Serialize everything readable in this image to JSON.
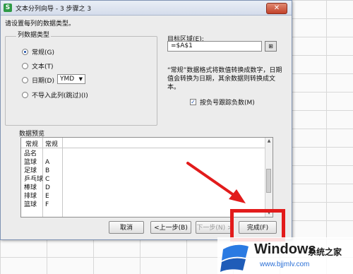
{
  "dialog": {
    "title": "文本分列向导 - 3 步骤之 3",
    "close_glyph": "✕",
    "app_icon_letter": "S",
    "instruction": "请设置每列的数据类型。"
  },
  "column_type": {
    "legend": "列数据类型",
    "options": [
      {
        "label": "常规(G)",
        "checked": true
      },
      {
        "label": "文本(T)",
        "checked": false
      },
      {
        "label": "日期(D)",
        "checked": false
      },
      {
        "label": "不导入此列(跳过)(I)",
        "checked": false
      }
    ],
    "date_format": "YMD"
  },
  "destination": {
    "label": "目标区域(E):",
    "value": "=$A$1"
  },
  "description": "“常规”数据格式将数值转换成数字，日期值会转换为日期，其余数据则转换成文本。",
  "negative_checkbox": {
    "label": "按负号跟踪负数(M)",
    "checked": true
  },
  "preview": {
    "label": "数据预览",
    "headers": [
      "常规",
      "常规"
    ],
    "col1": [
      "品名",
      "篮球",
      "足球",
      "乒乓球",
      "棒球",
      "排球",
      "篮球"
    ],
    "col2": [
      "",
      "A",
      "B",
      "C",
      "D",
      "E",
      "F"
    ]
  },
  "buttons": {
    "cancel": "取消",
    "back": "<上一步(B)",
    "next": "下一步(N) >",
    "finish": "完成(F)"
  },
  "watermark": {
    "title": "Windows",
    "subtitle": "系统之家",
    "url": "www.bjjmlv.com"
  },
  "colors": {
    "highlight": "#e21b1b",
    "link": "#2a6fd6"
  }
}
